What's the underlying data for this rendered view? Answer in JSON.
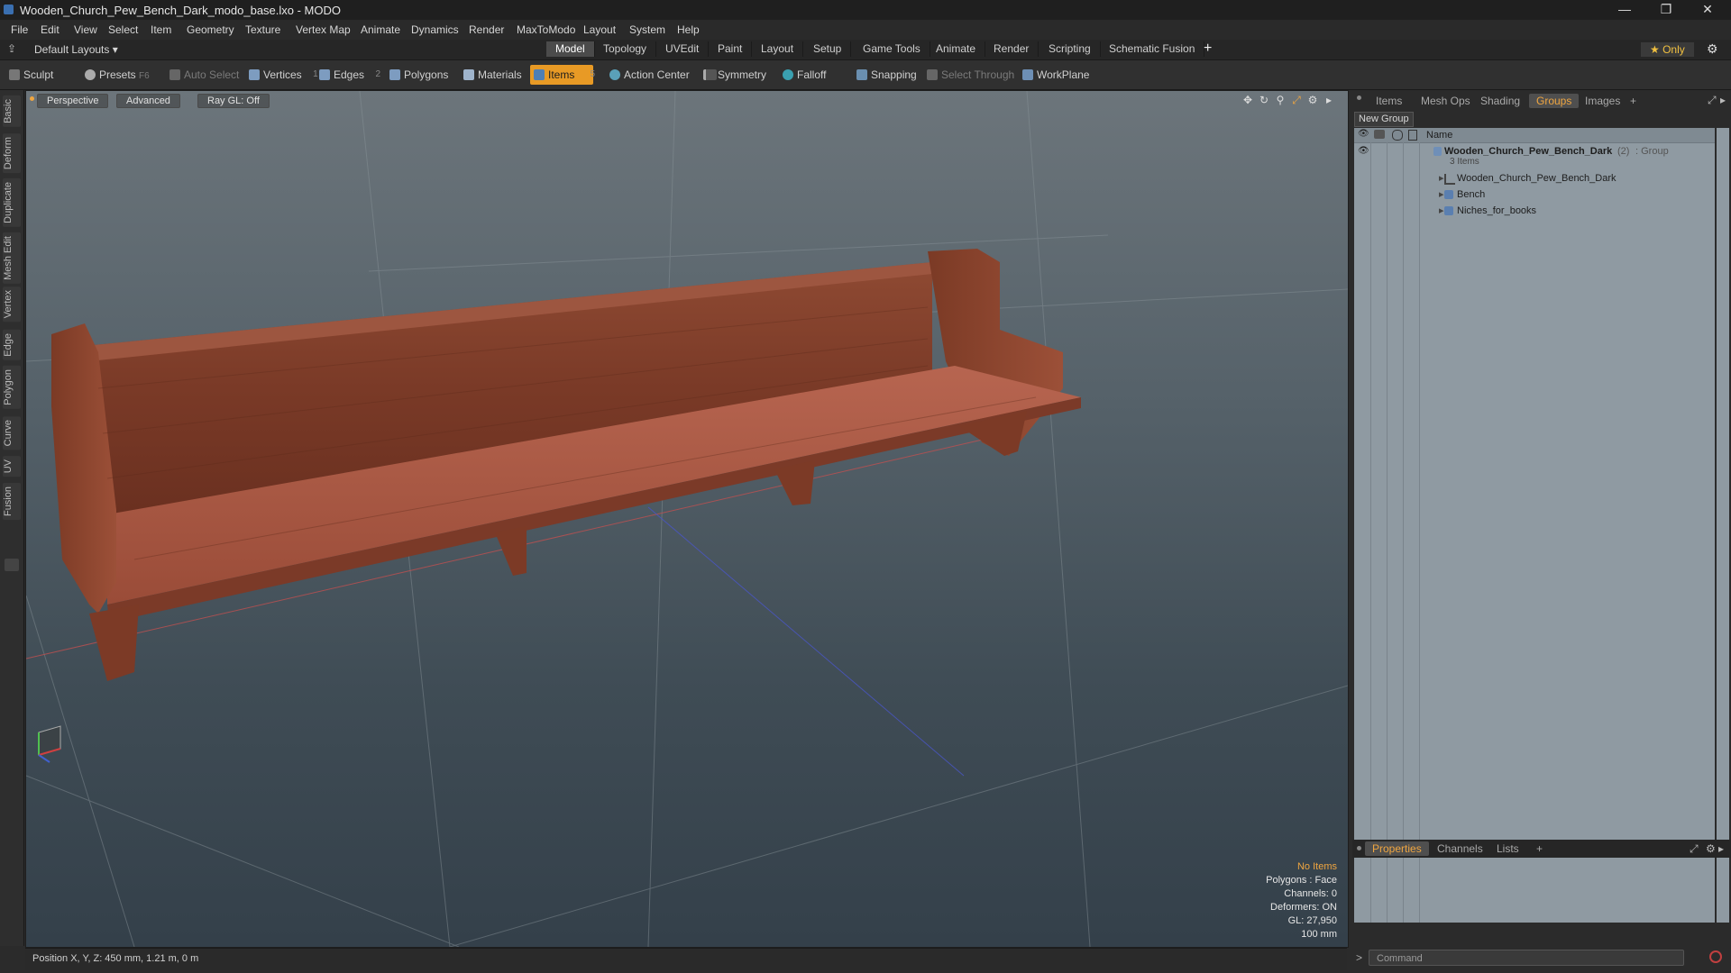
{
  "window": {
    "title": "Wooden_Church_Pew_Bench_Dark_modo_base.lxo - MODO",
    "minimize": "—",
    "restore": "❐",
    "close": "✕"
  },
  "menu": [
    "File",
    "Edit",
    "View",
    "Select",
    "Item",
    "Geometry",
    "Texture",
    "Vertex Map",
    "Animate",
    "Dynamics",
    "Render",
    "MaxToModo",
    "Layout",
    "System",
    "Help"
  ],
  "layout": {
    "preset": "Default Layouts ▾",
    "tabs": [
      "Model",
      "Topology",
      "UVEdit",
      "Paint",
      "Layout",
      "Setup",
      "Game Tools",
      "Animate",
      "Render",
      "Scripting",
      "Schematic Fusion"
    ],
    "active_tab": "Model",
    "add": "+",
    "only": "★  Only"
  },
  "toolbar": {
    "sculpt": "Sculpt",
    "presets": "Presets",
    "presets_key": "F6",
    "auto_select": "Auto Select",
    "vertices": "Vertices",
    "vertices_num": "1",
    "edges": "Edges",
    "edges_num": "2",
    "polygons": "Polygons",
    "materials": "Materials",
    "items": "Items",
    "items_num": "5",
    "action_center": "Action Center",
    "symmetry": "Symmetry",
    "falloff": "Falloff",
    "snapping": "Snapping",
    "select_through": "Select Through",
    "workplane": "WorkPlane"
  },
  "left_tabs": [
    "Basic",
    "Deform",
    "Duplicate",
    "Mesh Edit",
    "Vertex",
    "Edge",
    "Polygon",
    "Curve",
    "UV",
    "Fusion"
  ],
  "viewport": {
    "view": "Perspective",
    "shading": "Advanced",
    "raygl": "Ray GL: Off",
    "stats": {
      "selection": "No Items",
      "polygons": "Polygons : Face",
      "channels": "Channels: 0",
      "deformers": "Deformers: ON",
      "gl": "GL: 27,950",
      "grid": "100 mm"
    }
  },
  "status": {
    "position": "Position X, Y, Z:   450 mm, 1.21 m, 0 m"
  },
  "right_panel": {
    "tabs": [
      "Items",
      "Mesh Ops",
      "Shading",
      "Groups",
      "Images"
    ],
    "active_tab": "Groups",
    "add": "+",
    "new_group": "New Group",
    "column_name": "Name",
    "group": {
      "name": "Wooden_Church_Pew_Bench_Dark",
      "count": "(2)",
      "type": ": Group",
      "items_count": "3 Items"
    },
    "children": [
      "Wooden_Church_Pew_Bench_Dark",
      "Bench",
      "Niches_for_books"
    ],
    "bottom_tabs": [
      "Properties",
      "Channels",
      "Lists"
    ],
    "bottom_active": "Properties",
    "command_placeholder": "Command"
  },
  "colors": {
    "accent": "#e89a25",
    "wood": "#8a4530"
  }
}
